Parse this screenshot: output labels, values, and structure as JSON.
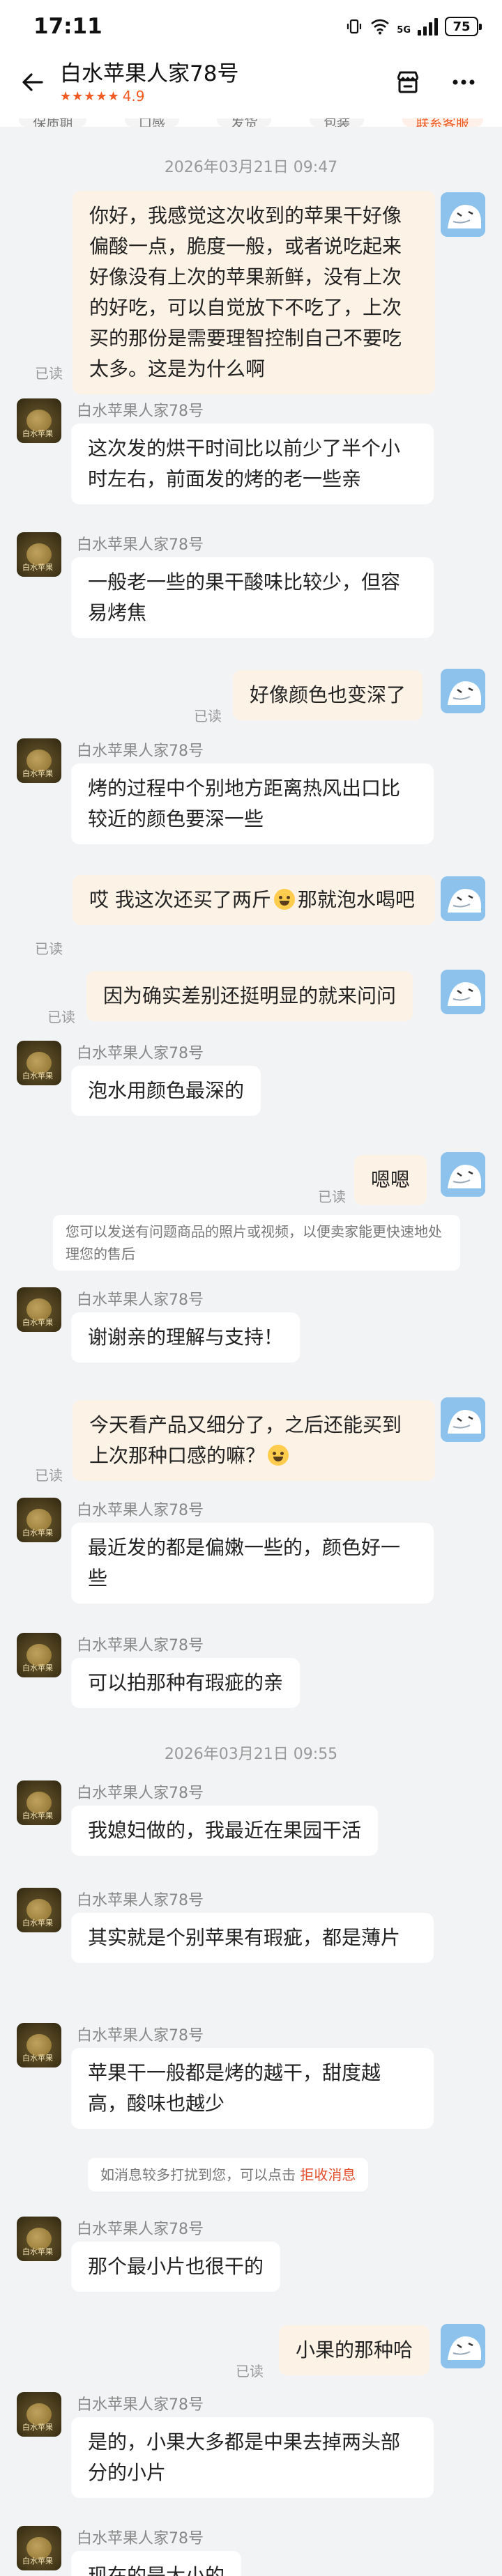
{
  "status_bar": {
    "time": "17:11",
    "network": "5G",
    "battery": "75"
  },
  "header": {
    "shop_name": "白水苹果人家78号",
    "stars": "★★★★★",
    "score": "4.9",
    "back_icon": "arrow-left-icon",
    "store_icon": "store-icon",
    "more_icon": "more-icon"
  },
  "quick_tabs": [
    "保质期",
    "口感",
    "发货",
    "包装",
    "联系客服"
  ],
  "colors": {
    "accent": "#f15a22",
    "self_bubble": "#fdf2e6",
    "other_bubble": "#ffffff",
    "background": "#f2f3f5",
    "link": "#e34d2a"
  },
  "shop_avatar_label": "白水苹果",
  "read_label": "已读",
  "conversation": [
    {
      "type": "time",
      "text": "2026年03月21日 09:47"
    },
    {
      "type": "out",
      "text": "你好，我感觉这次收到的苹果干好像偏酸一点，脆度一般，或者说吃起来好像没有上次的苹果新鲜，没有上次的好吃，可以自觉放下不吃了，上次买的那份是需要理智控制自己不要吃太多。这是为什么啊",
      "read": "已读"
    },
    {
      "type": "in",
      "sender": "白水苹果人家78号",
      "text": "这次发的烘干时间比以前少了半个小时左右，前面发的烤的老一些亲"
    },
    {
      "type": "in",
      "sender": "白水苹果人家78号",
      "text": "一般老一些的果干酸味比较少，但容易烤焦"
    },
    {
      "type": "out",
      "text": "好像颜色也变深了",
      "read": "已读"
    },
    {
      "type": "in",
      "sender": "白水苹果人家78号",
      "text": "烤的过程中个别地方距离热风出口比较近的颜色要深一些"
    },
    {
      "type": "out",
      "text_before": "哎 我这次还买了两斤",
      "text_after": "那就泡水喝吧",
      "emoji": "grinning-emoji",
      "read": "已读"
    },
    {
      "type": "out",
      "text": "因为确实差别还挺明显的就来问问",
      "read": "已读"
    },
    {
      "type": "in",
      "sender": "白水苹果人家78号",
      "text": "泡水用颜色最深的"
    },
    {
      "type": "out",
      "text": "嗯嗯",
      "read": "已读"
    },
    {
      "type": "system",
      "text": "您可以发送有问题商品的照片或视频，以便卖家能更快速地处理您的售后"
    },
    {
      "type": "in",
      "sender": "白水苹果人家78号",
      "text": "谢谢亲的理解与支持！"
    },
    {
      "type": "out",
      "text_before": "今天看产品又细分了，之后还能买到上次那种口感的嘛？",
      "text_after": "",
      "emoji": "grimacing-emoji",
      "read": "已读"
    },
    {
      "type": "in",
      "sender": "白水苹果人家78号",
      "text": "最近发的都是偏嫩一些的，颜色好一些"
    },
    {
      "type": "in",
      "sender": "白水苹果人家78号",
      "text": "可以拍那种有瑕疵的亲"
    },
    {
      "type": "time",
      "text": "2026年03月21日 09:55"
    },
    {
      "type": "in",
      "sender": "白水苹果人家78号",
      "text": "我媳妇做的，我最近在果园干活"
    },
    {
      "type": "in",
      "sender": "白水苹果人家78号",
      "text": "其实就是个别苹果有瑕疵，都是薄片"
    },
    {
      "type": "in",
      "sender": "白水苹果人家78号",
      "text": "苹果干一般都是烤的越干，甜度越高，酸味也越少"
    },
    {
      "type": "system",
      "text": "如消息较多打扰到您，可以点击",
      "link": "拒收消息"
    },
    {
      "type": "in",
      "sender": "白水苹果人家78号",
      "text": "那个最小片也很干的"
    },
    {
      "type": "out",
      "text": "小果的那种哈",
      "read": "已读"
    },
    {
      "type": "in",
      "sender": "白水苹果人家78号",
      "text": "是的，小果大多都是中果去掉两头部分的小片"
    },
    {
      "type": "in",
      "sender": "白水苹果人家78号",
      "text": "现在的是大小的"
    }
  ]
}
